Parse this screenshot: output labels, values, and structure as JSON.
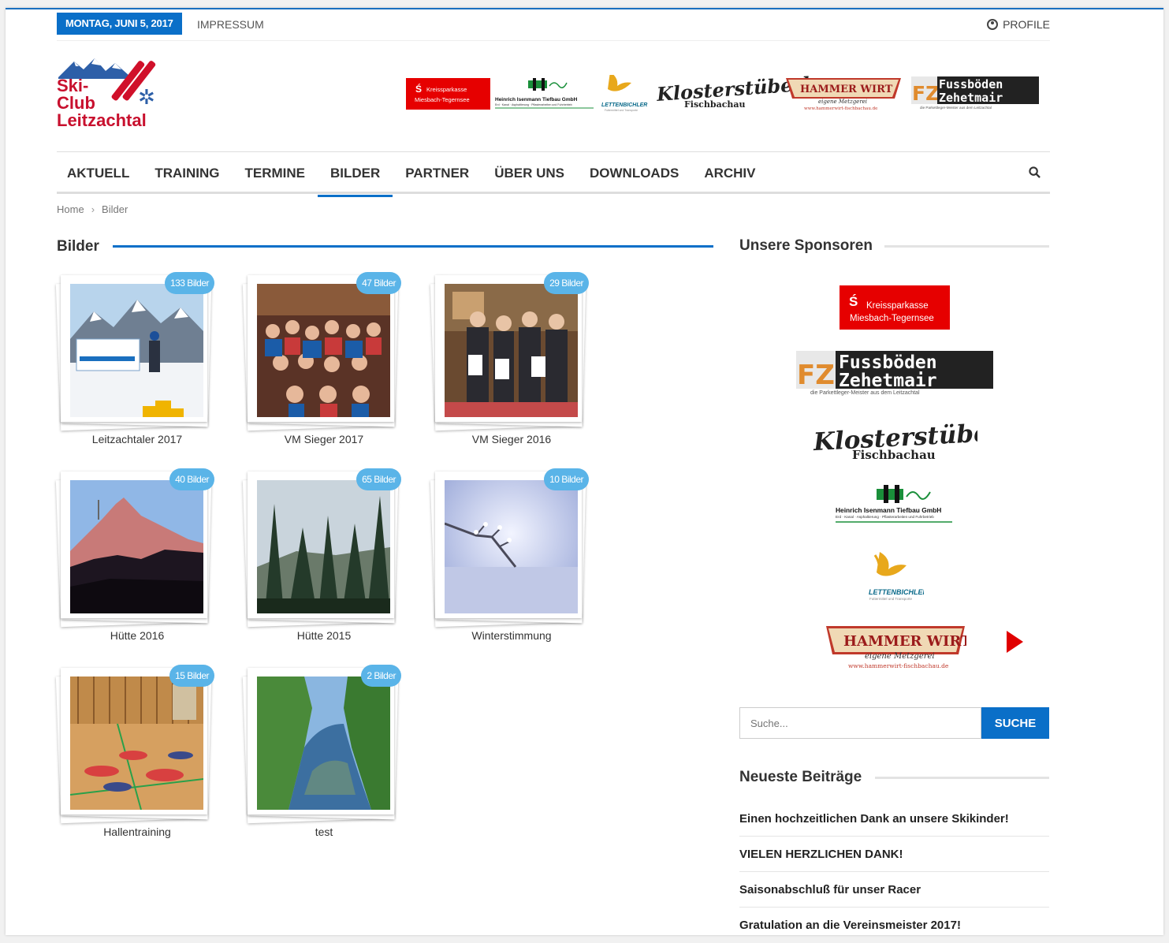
{
  "topbar": {
    "date": "MONTAG, JUNI 5, 2017",
    "impressum": "IMPRESSUM",
    "profile": "PROFILE"
  },
  "logo": {
    "line1": "Ski-",
    "line2": "Club",
    "line3": "Leitzachtal"
  },
  "sponsors": {
    "kreissparkasse": [
      "Kreissparkasse",
      "Miesbach-Tegernsee"
    ],
    "isenmann": [
      "Heinrich Isenmann Tiefbau GmbH",
      "Erd · Kanal · Asphaltierung · Pflasterarbeiten und Fuhrbetrieb"
    ],
    "lettenbichler": [
      "LETTENBICHLER",
      "Futtermittel und Transporte"
    ],
    "klosterstueberl": [
      "Klosterstüberl",
      "Fischbachau"
    ],
    "hammerwirt": [
      "HAMMER WIRT",
      "eigene Metzgerei",
      "www.hammerwirt-fischbachau.de"
    ],
    "zehetmair": [
      "FZ",
      "Fussböden",
      "Zehetmair",
      "die Parkettleger-Meister aus dem Leitzachtal"
    ]
  },
  "nav": {
    "items": [
      "AKTUELL",
      "TRAINING",
      "TERMINE",
      "BILDER",
      "PARTNER",
      "ÜBER UNS",
      "DOWNLOADS",
      "ARCHIV"
    ],
    "active": "BILDER"
  },
  "breadcrumb": {
    "home": "Home",
    "sep": "›",
    "current": "Bilder"
  },
  "gallery": {
    "title": "Bilder",
    "albums": [
      {
        "caption": "Leitzachtaler 2017",
        "count": "133 Bilder"
      },
      {
        "caption": "VM Sieger 2017",
        "count": "47 Bilder"
      },
      {
        "caption": "VM Sieger 2016",
        "count": "29 Bilder"
      },
      {
        "caption": "Hütte 2016",
        "count": "40 Bilder"
      },
      {
        "caption": "Hütte 2015",
        "count": "65 Bilder"
      },
      {
        "caption": "Winterstimmung",
        "count": "10 Bilder"
      },
      {
        "caption": "Hallentraining",
        "count": "15 Bilder"
      },
      {
        "caption": "test",
        "count": "2 Bilder"
      }
    ]
  },
  "sidebar": {
    "sponsors_title": "Unsere Sponsoren",
    "search_placeholder": "Suche...",
    "search_button": "SUCHE",
    "recent_title": "Neueste Beiträge",
    "recent_posts": [
      "Einen hochzeitlichen Dank an unsere Skikinder!",
      "VIELEN HERZLICHEN DANK!",
      "Saisonabschluß für unser Racer",
      "Gratulation an die Vereinsmeister 2017!"
    ]
  },
  "colors": {
    "accent": "#0a6fc8",
    "badge": "#5ab4e8",
    "sparkasse": "#e60000",
    "club_red": "#c8102e"
  }
}
